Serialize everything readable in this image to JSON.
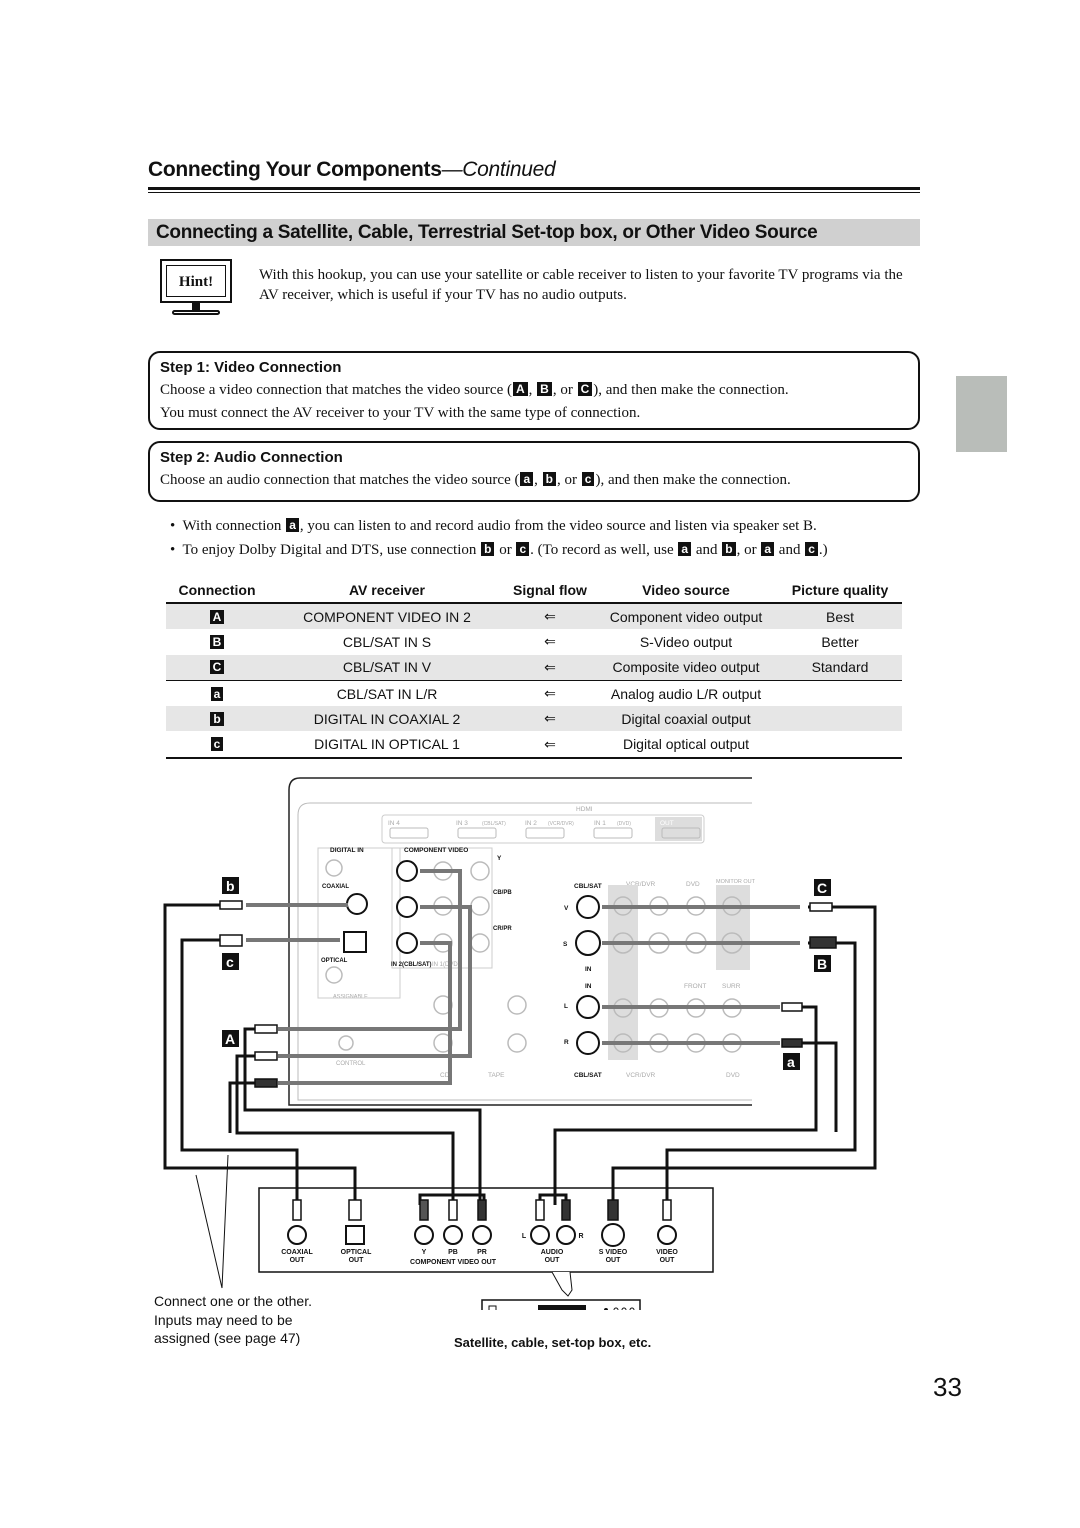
{
  "header": {
    "title": "Connecting Your Components",
    "continued": "—Continued"
  },
  "section_title": "Connecting a Satellite, Cable, Terrestrial Set-top box, or Other Video Source",
  "hint": {
    "label": "Hint!",
    "text": "With this hookup, you can use your satellite or cable receiver to listen to your favorite TV programs via the AV receiver, which is useful if your TV has no audio outputs."
  },
  "step1": {
    "title": "Step 1: Video Connection",
    "line1_a": "Choose a video connection that matches the video source (",
    "line1_b": "), and then make the connection.",
    "line2": "You must connect the AV receiver to your TV with the same type of connection.",
    "keys": [
      "A",
      "B",
      "C"
    ]
  },
  "step2": {
    "title": "Step 2: Audio Connection",
    "line1_a": "Choose an audio connection that matches the video source (",
    "line1_b": "), and then make the connection.",
    "keys": [
      "a",
      "b",
      "c"
    ]
  },
  "bullets": {
    "b1_a": "With connection",
    "b1_b": ", you can listen to and record audio from the video source and listen via speaker set B.",
    "b2_a": "To enjoy Dolby Digital and DTS, use connection",
    "b2_or": "or",
    "b2_b": ". (To record as well, use",
    "b2_and": "and",
    "b2_c": ", or",
    "b2_end": ".)"
  },
  "table": {
    "headers": [
      "Connection",
      "AV receiver",
      "Signal flow",
      "Video source",
      "Picture quality"
    ],
    "rows": [
      [
        "A",
        "COMPONENT VIDEO IN 2",
        "⇐",
        "Component video output",
        "Best"
      ],
      [
        "B",
        "CBL/SAT IN S",
        "⇐",
        "S-Video output",
        "Better"
      ],
      [
        "C",
        "CBL/SAT IN V",
        "⇐",
        "Composite video output",
        "Standard"
      ],
      [
        "a",
        "CBL/SAT IN L/R",
        "⇐",
        "Analog audio L/R output",
        ""
      ],
      [
        "b",
        "DIGITAL IN COAXIAL 2",
        "⇐",
        "Digital coaxial output",
        ""
      ],
      [
        "c",
        "DIGITAL IN OPTICAL 1",
        "⇐",
        "Digital optical output",
        ""
      ]
    ]
  },
  "diagram": {
    "receiver_labels": {
      "hdmi": "HDMI",
      "assignable": "ASSIGNABLE",
      "in4": "IN 4",
      "in3": "IN 3",
      "in3_sub": "(CBL/SAT)",
      "in2": "IN 2",
      "in2_sub": "(VCR/DVR)",
      "in1": "IN 1",
      "in1_sub": "(DVD)",
      "out": "OUT",
      "digital_in": "DIGITAL IN",
      "coaxial": "COAXIAL",
      "optical": "OPTICAL",
      "component_video": "COMPONENT VIDEO",
      "y": "Y",
      "cb": "CB/PB",
      "cr": "CR/PR",
      "in2cbl": "IN 2(CBL/SAT)",
      "in1dvd": "IN 1(DVD)",
      "cblsat": "CBL/SAT",
      "vcrdvr": "VCR/DVR",
      "dvd": "DVD",
      "monitor_out": "MONITOR OUT",
      "v": "V",
      "s": "S",
      "l": "L",
      "r": "R",
      "in": "IN",
      "front": "FRONT",
      "surr": "SURR",
      "cd": "CD",
      "tape": "TAPE",
      "control": "CONTROL"
    },
    "connector_keys": {
      "b": "b",
      "c": "c",
      "A": "A",
      "C": "C",
      "B": "B",
      "a": "a"
    },
    "source_labels": {
      "coaxial": "COAXIAL",
      "optical": "OPTICAL",
      "out": "OUT",
      "y": "Y",
      "pb": "PB",
      "pr": "PR",
      "component_video_out": "COMPONENT VIDEO OUT",
      "audio": "AUDIO",
      "svideo": "S VIDEO",
      "video": "VIDEO",
      "l": "L",
      "r": "R"
    },
    "caption_left": [
      "Connect one or the other.",
      "Inputs may need to be",
      "assigned (see page 47)"
    ],
    "caption_device": "Satellite, cable, set-top box, etc."
  },
  "page_number": "33",
  "colors": {
    "banner": "#d0d0d0",
    "row_shade": "#e6e6e6",
    "side_tab": "#b9bdb9",
    "cable": "#111111"
  }
}
